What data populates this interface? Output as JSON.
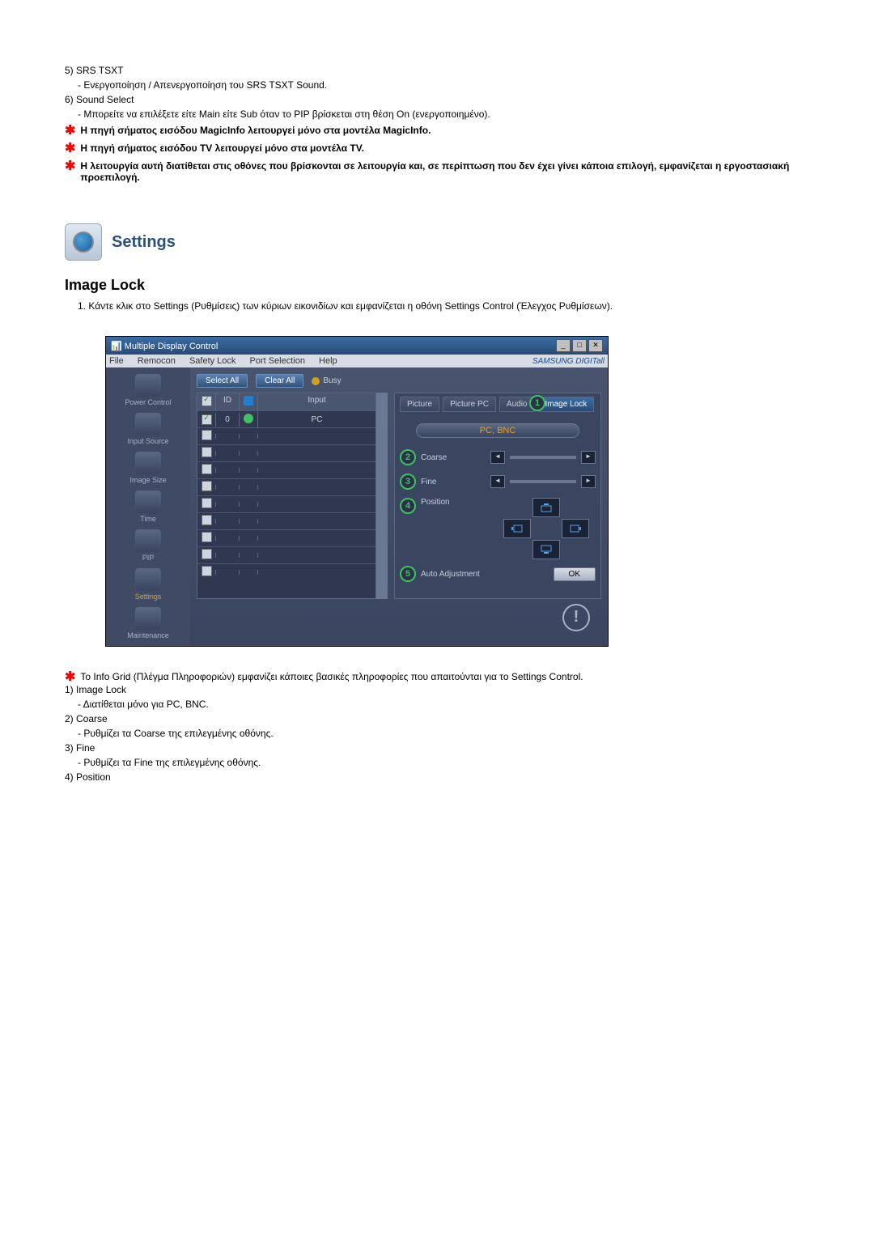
{
  "items_top": [
    {
      "num": "5)",
      "title": "SRS TSXT",
      "desc": "- Ενεργοποίηση / Απενεργοποίηση του SRS TSXT Sound."
    },
    {
      "num": "6)",
      "title": "Sound Select",
      "desc": "- Μπορείτε να επιλέξετε είτε Main είτε Sub όταν το PIP βρίσκεται στη θέση On (ενεργοποιημένο)."
    }
  ],
  "stars": [
    "Η πηγή σήματος εισόδου MagicInfo λειτουργεί μόνο στα μοντέλα MagicInfo.",
    "Η πηγή σήματος εισόδου TV λειτουργεί μόνο στα μοντέλα TV.",
    "Η λειτουργία αυτή διατίθεται στις οθόνες που βρίσκονται σε λειτουργία και, σε περίπτωση που δεν έχει γίνει κάποια επιλογή, εμφανίζεται η εργοστασιακή προεπιλογή."
  ],
  "settings_title": "Settings",
  "section_title": "Image Lock",
  "section_intro_num": "1.",
  "section_intro": "Κάντε κλικ στο Settings (Ρυθμίσεις) των κύριων εικονιδίων και εμφανίζεται η οθόνη Settings Control (Έλεγχος Ρυθμίσεων).",
  "app": {
    "title": "Multiple Display Control",
    "menus": [
      "File",
      "Remocon",
      "Safety Lock",
      "Port Selection",
      "Help"
    ],
    "brand": "SAMSUNG DIGITall",
    "toolbar": {
      "select_all": "Select All",
      "clear_all": "Clear All",
      "busy": "Busy"
    },
    "sidebar": [
      "Power Control",
      "Input Source",
      "Image Size",
      "Time",
      "PIP",
      "Settings",
      "Maintenance"
    ],
    "sidebar_active_index": 5,
    "grid": {
      "headers": {
        "chk": "",
        "id": "ID",
        "stat": "",
        "input": "Input"
      },
      "rows": [
        {
          "checked": true,
          "id": "0",
          "status": "ok",
          "input": "PC"
        },
        {
          "checked": false
        },
        {
          "checked": false
        },
        {
          "checked": false
        },
        {
          "checked": false
        },
        {
          "checked": false
        },
        {
          "checked": false
        },
        {
          "checked": false
        },
        {
          "checked": false
        },
        {
          "checked": false
        }
      ]
    },
    "tabs": [
      "Picture",
      "Picture PC",
      "Audio",
      "Image Lock"
    ],
    "active_tab_index": 3,
    "mode_label": "PC, BNC",
    "controls": {
      "coarse": "Coarse",
      "fine": "Fine",
      "position": "Position",
      "auto": "Auto Adjustment"
    },
    "ok": "OK",
    "callouts": [
      "1",
      "2",
      "3",
      "4",
      "5"
    ]
  },
  "notes_star": "Το Info Grid (Πλέγμα Πληροφοριών) εμφανίζει κάποιες βασικές πληροφορίες που απαιτούνται για το Settings Control.",
  "notes_items": [
    {
      "num": "1)",
      "title": "Image Lock",
      "desc": "- Διατίθεται μόνο για PC, BNC."
    },
    {
      "num": "2)",
      "title": "Coarse",
      "desc": "- Ρυθμίζει τα Coarse της επιλεγμένης οθόνης."
    },
    {
      "num": "3)",
      "title": "Fine",
      "desc": "- Ρυθμίζει τα Fine της επιλεγμένης οθόνης."
    },
    {
      "num": "4)",
      "title": "Position",
      "desc": ""
    }
  ]
}
